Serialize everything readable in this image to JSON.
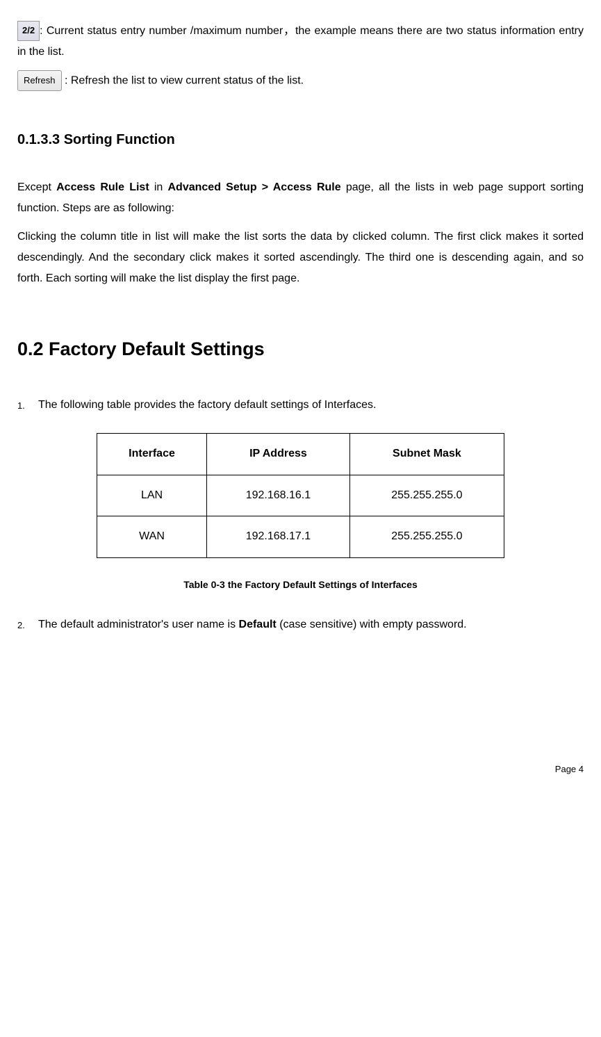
{
  "icons": {
    "pager_label": "2/2",
    "refresh_label": "Refresh"
  },
  "desc": {
    "pager_text": ": Current status entry number /maximum number，the example means there are two status information entry in the list.",
    "refresh_text": " :   Refresh the list to view current status of the list."
  },
  "section_0133": {
    "heading": "0.1.3.3  Sorting Function",
    "p1_a": "Except ",
    "p1_b": "Access Rule List",
    "p1_c": " in ",
    "p1_d": "Advanced Setup > Access Rule",
    "p1_e": " page, all the lists in web page support sorting function. Steps are as following:",
    "p2": "Clicking the column title in list will make the list sorts the data by clicked column. The first click makes it sorted descendingly. And the secondary click makes it sorted ascendingly. The third one is descending again, and so forth. Each sorting will make the list display the first page."
  },
  "section_02": {
    "heading": "0.2    Factory Default Settings",
    "li1_num": "1.",
    "li1": "The following table provides the factory default settings of Interfaces.",
    "table": {
      "headers": [
        "Interface",
        "IP Address",
        "Subnet Mask"
      ],
      "rows": [
        [
          "LAN",
          "192.168.16.1",
          "255.255.255.0"
        ],
        [
          "WAN",
          "192.168.17.1",
          "255.255.255.0"
        ]
      ]
    },
    "table_caption": "Table 0-3 the Factory Default Settings of Interfaces",
    "li2_num": "2.",
    "li2_a": "The default administrator's user name is ",
    "li2_b": "Default",
    "li2_c": " (case sensitive) with empty password."
  },
  "page_number": "Page 4"
}
